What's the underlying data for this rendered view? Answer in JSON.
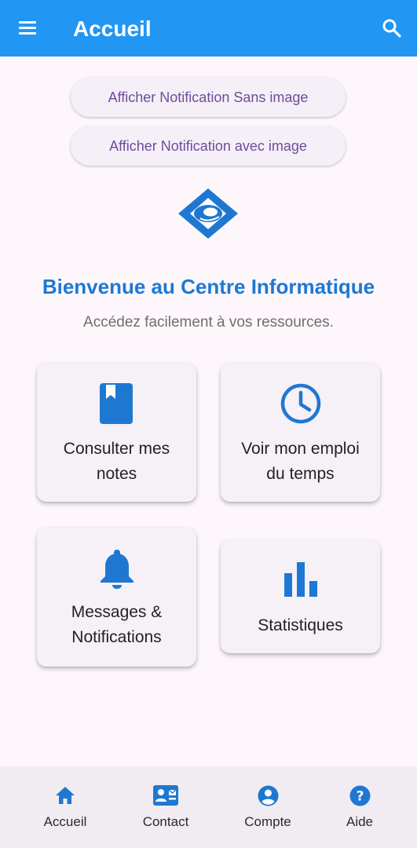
{
  "appbar": {
    "title": "Accueil",
    "icons": [
      "menu-icon",
      "search-icon"
    ]
  },
  "actions": {
    "notify_no_image": "Afficher Notification Sans image",
    "notify_with_image": "Afficher Notification avec image"
  },
  "hero": {
    "logo_icon": "centre-logo-icon",
    "title": "Bienvenue au Centre Informatique",
    "subtitle": "Accédez facilement à vos ressources."
  },
  "cards": [
    {
      "icon": "book-icon",
      "label_line1": "Consulter mes",
      "label_line2": "notes"
    },
    {
      "icon": "clock-icon",
      "label_line1": "Voir mon emploi",
      "label_line2": "du temps"
    },
    {
      "icon": "bell-icon",
      "label_line1": "Messages &",
      "label_line2": "Notifications"
    },
    {
      "icon": "bar-chart-icon",
      "label_line1": "Statistiques"
    }
  ],
  "bottom_nav": [
    {
      "icon": "home-icon",
      "label": "Accueil"
    },
    {
      "icon": "contact-card-icon",
      "label": "Contact"
    },
    {
      "icon": "account-circle-icon",
      "label": "Compte"
    },
    {
      "icon": "help-icon",
      "label": "Aide"
    }
  ],
  "colors": {
    "appbar": "#2196f3",
    "accent": "#1e78d2",
    "pill_text": "#6b4e9b",
    "background": "#fdf7fc"
  }
}
